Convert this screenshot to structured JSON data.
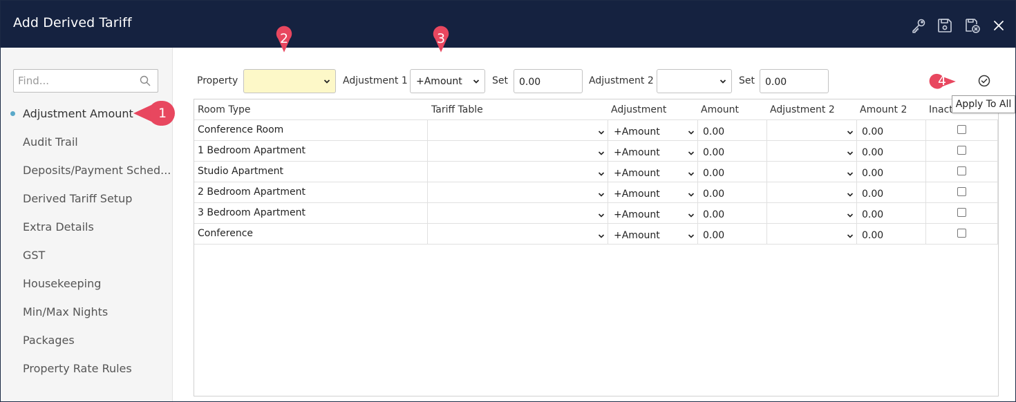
{
  "window": {
    "title": "Add Derived Tariff",
    "icons": [
      "key-icon",
      "save-icon",
      "save-close-icon",
      "close-icon"
    ]
  },
  "sidebar": {
    "search_placeholder": "Find...",
    "items": [
      {
        "label": "Adjustment Amount",
        "active": true
      },
      {
        "label": "Audit Trail"
      },
      {
        "label": "Deposits/Payment Sched..."
      },
      {
        "label": "Derived Tariff Setup"
      },
      {
        "label": "Extra Details"
      },
      {
        "label": "GST"
      },
      {
        "label": "Housekeeping"
      },
      {
        "label": "Min/Max Nights"
      },
      {
        "label": "Packages"
      },
      {
        "label": "Property Rate Rules"
      }
    ]
  },
  "filters": {
    "property_label": "Property",
    "property_value": "",
    "adjustment1_label": "Adjustment 1",
    "adjustment1_value": "+Amount",
    "set1_label": "Set",
    "set1_value": "0.00",
    "adjustment2_label": "Adjustment 2",
    "adjustment2_value": "",
    "set2_label": "Set",
    "set2_value": "0.00",
    "apply_tooltip": "Apply To All"
  },
  "table": {
    "columns": [
      "Room Type",
      "Tariff Table",
      "Adjustment",
      "Amount",
      "Adjustment 2",
      "Amount 2",
      "Inact"
    ],
    "rows": [
      {
        "room_type": "Conference Room",
        "tariff_table": "",
        "adjustment": "+Amount",
        "amount": "0.00",
        "adjustment2": "",
        "amount2": "0.00",
        "inactive": false
      },
      {
        "room_type": "1 Bedroom Apartment",
        "tariff_table": "",
        "adjustment": "+Amount",
        "amount": "0.00",
        "adjustment2": "",
        "amount2": "0.00",
        "inactive": false
      },
      {
        "room_type": "Studio Apartment",
        "tariff_table": "",
        "adjustment": "+Amount",
        "amount": "0.00",
        "adjustment2": "",
        "amount2": "0.00",
        "inactive": false
      },
      {
        "room_type": "2 Bedroom Apartment",
        "tariff_table": "",
        "adjustment": "+Amount",
        "amount": "0.00",
        "adjustment2": "",
        "amount2": "0.00",
        "inactive": false
      },
      {
        "room_type": "3 Bedroom Apartment",
        "tariff_table": "",
        "adjustment": "+Amount",
        "amount": "0.00",
        "adjustment2": "",
        "amount2": "0.00",
        "inactive": false
      },
      {
        "room_type": "Conference",
        "tariff_table": "",
        "adjustment": "+Amount",
        "amount": "0.00",
        "adjustment2": "",
        "amount2": "0.00",
        "inactive": false
      }
    ]
  },
  "callouts": [
    "1",
    "2",
    "3",
    "4"
  ],
  "colors": {
    "titlebar": "#152240",
    "callout": "#e8475f",
    "property_field": "#fdf8c8",
    "active_dot": "#5aa9c9"
  }
}
